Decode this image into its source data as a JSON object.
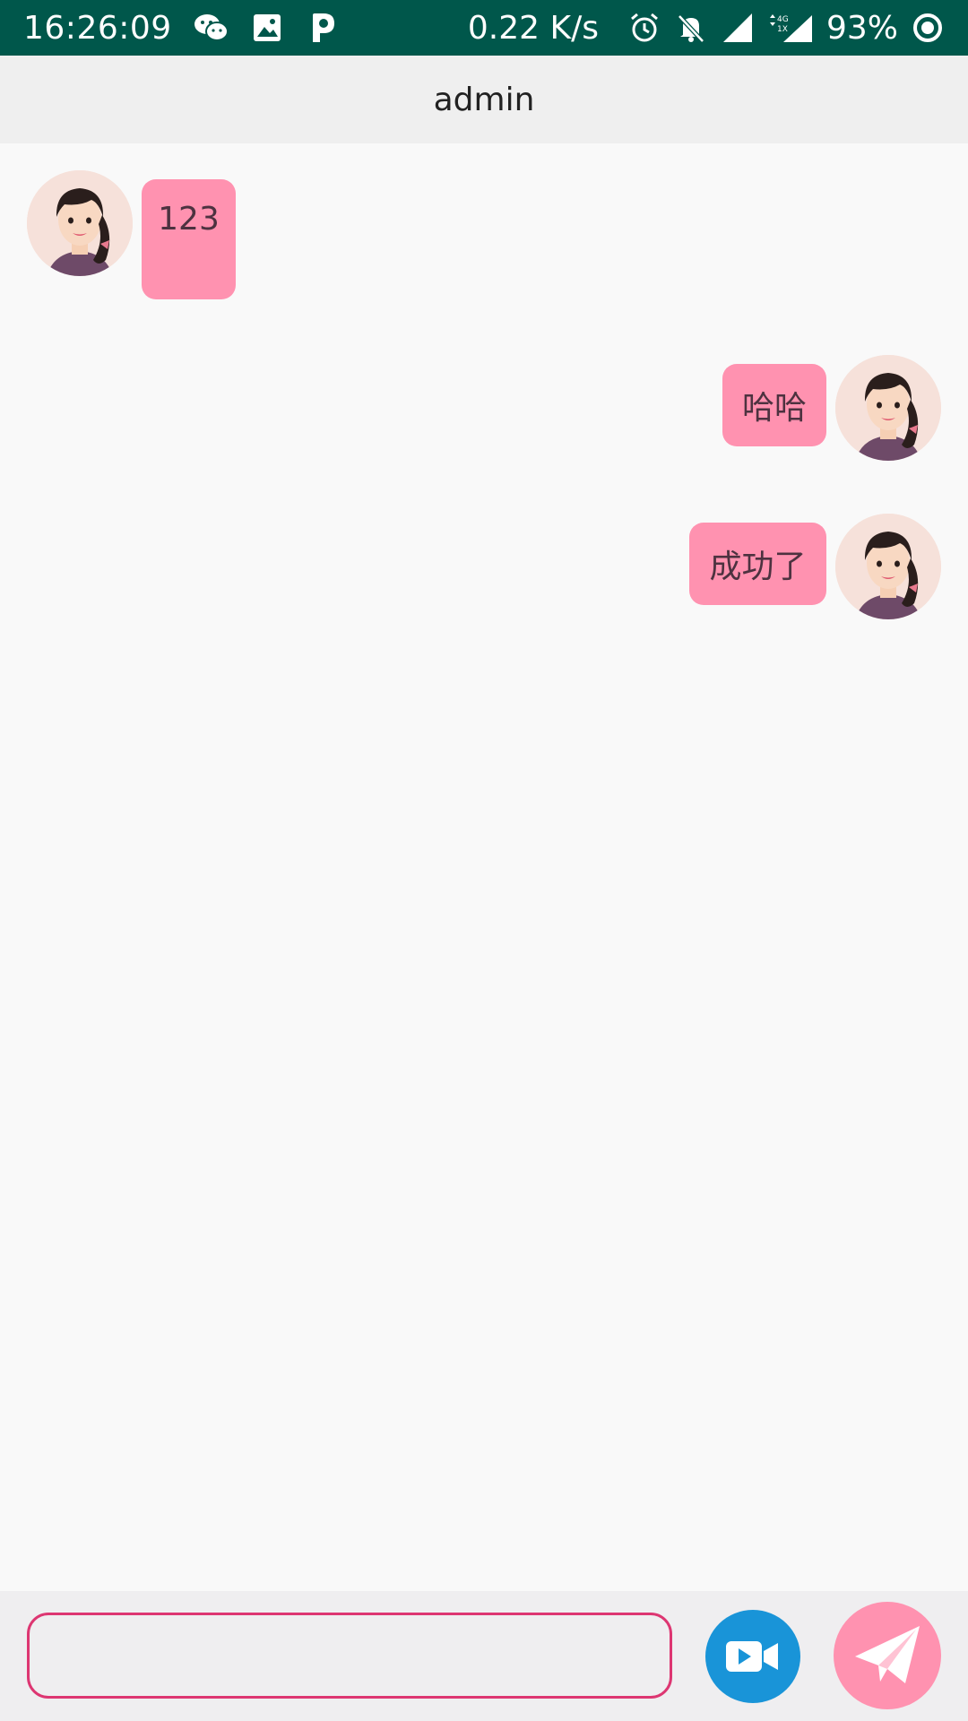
{
  "status_bar": {
    "time": "16:26:09",
    "net_speed": "0.22 K/s",
    "battery": "93%",
    "signal_badge_top": "4G",
    "signal_badge_bottom": "1X",
    "icons": [
      "wechat-icon",
      "gallery-icon",
      "p-app-icon",
      "alarm-icon",
      "bell-muted-icon",
      "signal-icon",
      "signal-4g-icon",
      "battery-ring-icon"
    ]
  },
  "header": {
    "title": "admin"
  },
  "messages": [
    {
      "side": "left",
      "text": "123"
    },
    {
      "side": "right",
      "text": "哈哈"
    },
    {
      "side": "right",
      "text": "成功了"
    }
  ],
  "input_bar": {
    "input_value": "",
    "input_placeholder": "",
    "video_icon": "video-camera-icon",
    "send_icon": "paper-plane-icon"
  },
  "colors": {
    "status_bar": "#00574b",
    "bubble": "#ff92b0",
    "input_border": "#dd3672",
    "video_button": "#1994d8",
    "send_button": "#ff92b0"
  }
}
